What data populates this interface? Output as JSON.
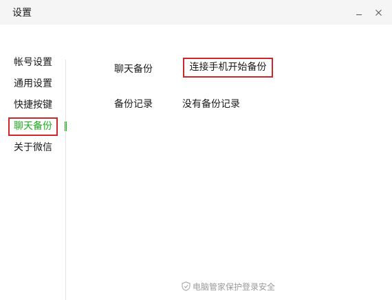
{
  "window": {
    "title": "设置"
  },
  "titlebar": {
    "minimize_icon": "minimize-icon",
    "close_icon": "close-icon"
  },
  "sidebar": {
    "items": [
      {
        "label": "帐号设置",
        "active": false
      },
      {
        "label": "通用设置",
        "active": false
      },
      {
        "label": "快捷按键",
        "active": false
      },
      {
        "label": "聊天备份",
        "active": true
      },
      {
        "label": "关于微信",
        "active": false
      }
    ]
  },
  "main": {
    "chat_backup_label": "聊天备份",
    "backup_button_label": "连接手机开始备份",
    "backup_record_label": "备份记录",
    "backup_record_value": "没有备份记录"
  },
  "footer": {
    "icon": "shield-icon",
    "text": "电脑管家保护登录安全"
  },
  "colors": {
    "accent_green": "#1aad19",
    "highlight_red": "#c9272c",
    "titlebar_bg": "#f5f5f5",
    "footer_text": "#9a9a9a"
  }
}
